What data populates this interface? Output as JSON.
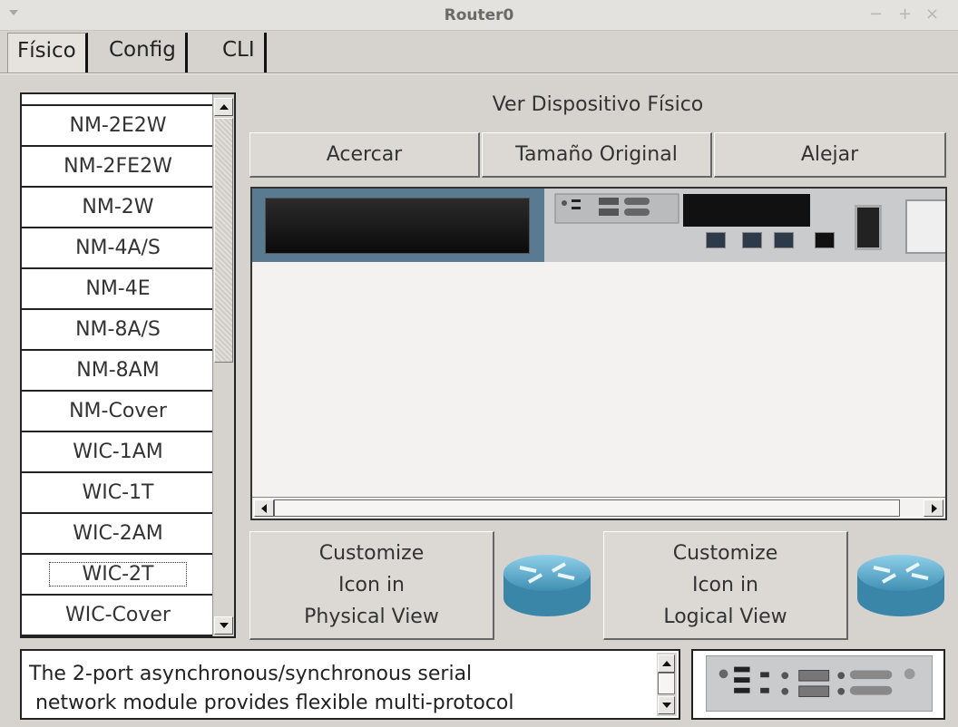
{
  "window": {
    "title": "Router0",
    "controls": [
      "−",
      "+",
      "×"
    ]
  },
  "tabs": [
    {
      "label": "Físico",
      "active": true
    },
    {
      "label": "Config",
      "active": false
    },
    {
      "label": "CLI",
      "active": false
    }
  ],
  "modules": {
    "items": [
      "NM-2E2W",
      "NM-2FE2W",
      "NM-2W",
      "NM-4A/S",
      "NM-4E",
      "NM-8A/S",
      "NM-8AM",
      "NM-Cover",
      "WIC-1AM",
      "WIC-1T",
      "WIC-2AM",
      "WIC-2T",
      "WIC-Cover"
    ],
    "selected": "WIC-2T"
  },
  "physical_view": {
    "heading": "Ver Dispositivo Físico",
    "zoom_in": "Acercar",
    "original_size": "Tamaño Original",
    "zoom_out": "Alejar"
  },
  "customize": {
    "physical_lines": [
      "Customize",
      "Icon in",
      "Physical View"
    ],
    "logical_lines": [
      "Customize",
      "Icon in",
      "Logical View"
    ]
  },
  "description": {
    "line1": "The 2-port asynchronous/synchronous serial",
    "line2": " network module provides flexible multi-protocol"
  },
  "colors": {
    "window_bg": "#d6d3ce",
    "router_icon": "#5aa3c3"
  }
}
